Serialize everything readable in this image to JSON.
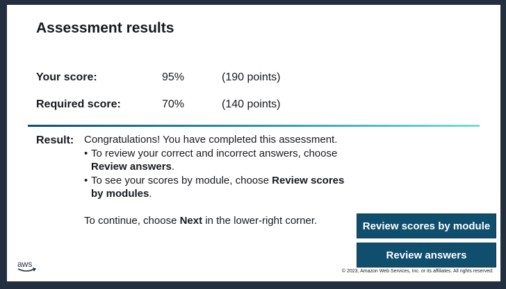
{
  "page": {
    "title": "Assessment results"
  },
  "scores": {
    "your": {
      "label": "Your score:",
      "percent": "95%",
      "points": "(190 points)"
    },
    "required": {
      "label": "Required score:",
      "percent": "70%",
      "points": "(140 points)"
    }
  },
  "result": {
    "label": "Result:",
    "intro": "Congratulations! You have completed this assessment.",
    "bullet1_prefix": "To review your correct and incorrect answers, choose ",
    "bullet1_bold": "Review answers",
    "bullet1_suffix": ".",
    "bullet2_prefix": "To see your scores by module, choose ",
    "bullet2_bold": "Review scores by modules",
    "bullet2_suffix": ".",
    "continue_prefix": "To continue, choose ",
    "continue_bold": "Next",
    "continue_suffix": " in the lower-right corner."
  },
  "buttons": {
    "review_scores": "Review scores by module",
    "review_answers": "Review answers"
  },
  "footer": {
    "logo_text": "aws",
    "copyright": "© 2023, Amazon Web Services, Inc. or its affiliates. All rights reserved."
  },
  "colors": {
    "button_bg": "#0f4e6d",
    "frame_bg": "#232f3e",
    "divider_start": "#0a4f73",
    "divider_end": "#6fe0d6"
  },
  "icons": {
    "logo": "aws-smile-logo"
  }
}
